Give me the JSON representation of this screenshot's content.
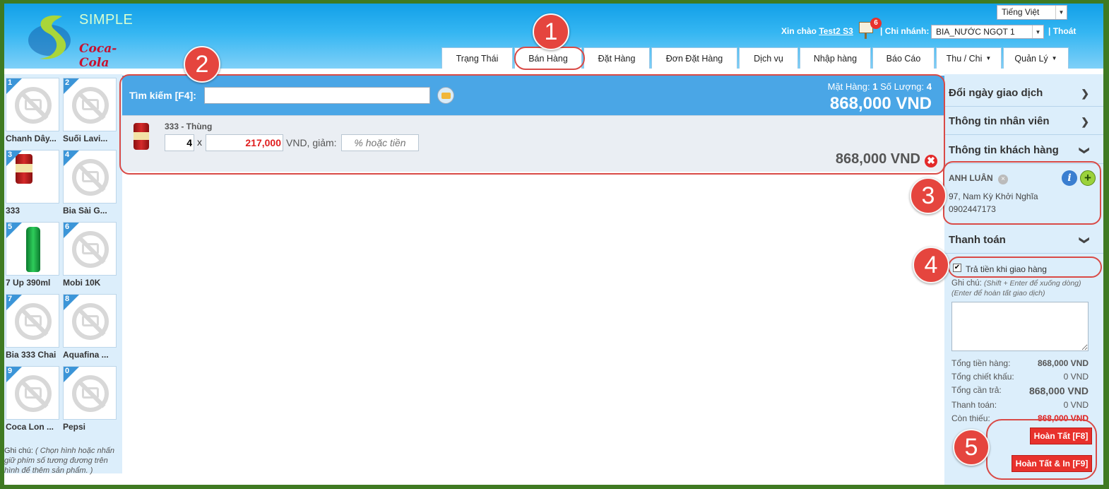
{
  "header": {
    "logo_text": "SIMPLE",
    "logo_brand": "Coca-Cola",
    "language": "Tiếng Việt",
    "greeting_prefix": "Xin chào",
    "user": "Test2 S3",
    "notification_count": "6",
    "branch_label": "Chi nhánh:",
    "branch_value": "BIA_NƯỚC NGỌT 1",
    "logout": "Thoát"
  },
  "nav": [
    {
      "label": "Trạng Thái"
    },
    {
      "label": "Bán Hàng"
    },
    {
      "label": "Đặt Hàng"
    },
    {
      "label": "Đơn Đặt Hàng"
    },
    {
      "label": "Dịch vụ"
    },
    {
      "label": "Nhập hàng"
    },
    {
      "label": "Báo Cáo"
    },
    {
      "label": "Thu / Chi"
    },
    {
      "label": "Quản Lý"
    }
  ],
  "markers": [
    "1",
    "2",
    "3",
    "4",
    "5"
  ],
  "products": [
    {
      "num": "1",
      "name": "Chanh Dây..."
    },
    {
      "num": "2",
      "name": "Suối Lavi..."
    },
    {
      "num": "3",
      "name": "333"
    },
    {
      "num": "4",
      "name": "Bia Sài G..."
    },
    {
      "num": "5",
      "name": "7 Up 390ml"
    },
    {
      "num": "6",
      "name": "Mobi 10K"
    },
    {
      "num": "7",
      "name": "Bia 333 Chai"
    },
    {
      "num": "8",
      "name": "Aquafina ..."
    },
    {
      "num": "9",
      "name": "Coca Lon ..."
    },
    {
      "num": "0",
      "name": "Pepsi"
    }
  ],
  "left_note": {
    "label": "Ghi chú:",
    "text": "( Chọn hình hoặc nhấn giữ phím số tương đương trên hình để thêm sản phẩm. )"
  },
  "search": {
    "label": "Tìm kiếm [F4]:",
    "value": "",
    "mat_hang_label": "Mặt Hàng:",
    "mat_hang_value": "1",
    "so_luong_label": "Số Lượng:",
    "so_luong_value": "4",
    "grand_total": "868,000 VND"
  },
  "cart": {
    "name": "333 - Thùng",
    "qty": "4",
    "times": "x",
    "price": "217,000",
    "price_suffix": "VND, giảm:",
    "discount_placeholder": "% hoặc tiền",
    "line_total": "868,000 VND",
    "remove_icon": "✖"
  },
  "right": {
    "sections": [
      {
        "label": "Đổi ngày giao dịch",
        "chev": "❯"
      },
      {
        "label": "Thông tin nhân viên",
        "chev": "❯"
      },
      {
        "label": "Thông tin khách hàng",
        "chev": "❯"
      }
    ],
    "customer": {
      "name": "ANH LUÂN",
      "remove": "×",
      "info_icon": "i",
      "add_icon": "+",
      "address": "97, Nam Kỳ Khởi Nghĩa",
      "phone": "0902447173"
    },
    "payment_title": "Thanh toán",
    "payment_chev": "❯",
    "cod_checked": "✔",
    "cod_label": "Trả tiền khi giao hàng",
    "note_label": "Ghi chú:",
    "note_hint1": "(Shift + Enter để xuống dòng)",
    "note_hint2": "(Enter để hoàn tất giao dịch)",
    "summary": [
      {
        "label": "Tổng tiền hàng:",
        "value": "868,000 VND"
      },
      {
        "label": "Tổng chiết khấu:",
        "value": "0 VND"
      },
      {
        "label": "Tổng cần trả:",
        "value": "868,000 VND"
      },
      {
        "label": "Thanh toán:",
        "value": "0 VND"
      },
      {
        "label": "Còn thiếu:",
        "value": "868,000 VND"
      }
    ],
    "btn_finish": "Hoàn Tất [F8]",
    "btn_finish_print": "Hoàn Tất & In [F9]"
  },
  "colors": {
    "header_blue": "#1fa6ea",
    "accent_red": "#e8312c",
    "panel_blue": "#dceefb",
    "marker_red": "#e5453e"
  }
}
